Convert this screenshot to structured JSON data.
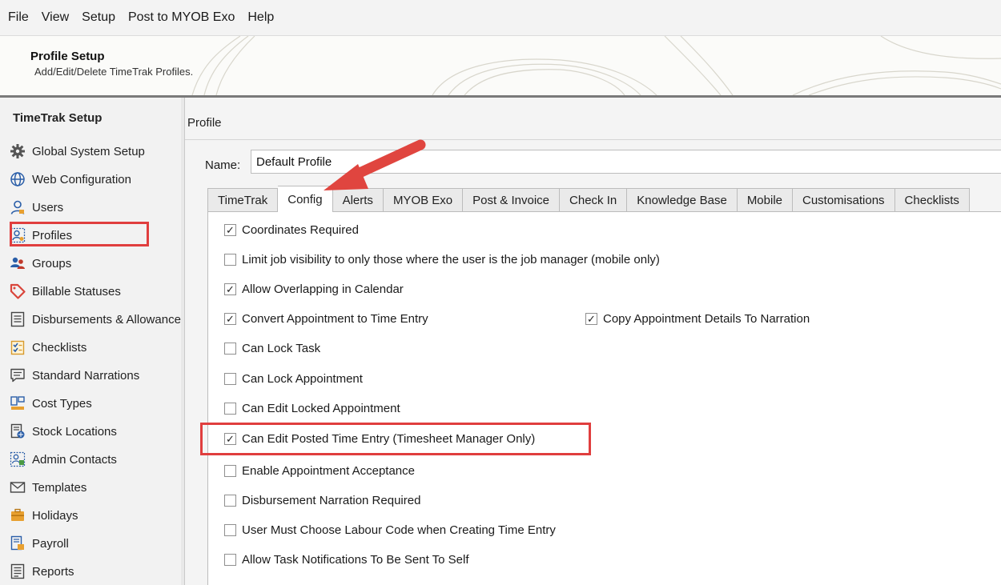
{
  "menu": [
    "File",
    "View",
    "Setup",
    "Post to MYOB Exo",
    "Help"
  ],
  "header": {
    "title": "Profile Setup",
    "subtitle": "Add/Edit/Delete TimeTrak Profiles."
  },
  "sidebar": {
    "title": "TimeTrak Setup",
    "items": [
      {
        "label": "Global System Setup",
        "icon": "gear-icon"
      },
      {
        "label": "Web Configuration",
        "icon": "globe-icon"
      },
      {
        "label": "Users",
        "icon": "user-icon"
      },
      {
        "label": "Profiles",
        "icon": "profile-icon"
      },
      {
        "label": "Groups",
        "icon": "group-icon"
      },
      {
        "label": "Billable Statuses",
        "icon": "tag-icon"
      },
      {
        "label": "Disbursements & Allowances",
        "icon": "list-icon"
      },
      {
        "label": "Checklists",
        "icon": "checklist-icon"
      },
      {
        "label": "Standard Narrations",
        "icon": "narration-icon"
      },
      {
        "label": "Cost Types",
        "icon": "cost-types-icon"
      },
      {
        "label": "Stock Locations",
        "icon": "stock-location-icon"
      },
      {
        "label": "Admin Contacts",
        "icon": "admin-contacts-icon"
      },
      {
        "label": "Templates",
        "icon": "envelope-icon"
      },
      {
        "label": "Holidays",
        "icon": "holiday-icon"
      },
      {
        "label": "Payroll",
        "icon": "payroll-icon"
      },
      {
        "label": "Reports",
        "icon": "report-icon"
      }
    ],
    "highlighted": "Profiles"
  },
  "main": {
    "title": "Profile",
    "name_label": "Name:",
    "name_value": "Default Profile",
    "tabs": [
      "TimeTrak",
      "Config",
      "Alerts",
      "MYOB Exo",
      "Post & Invoice",
      "Check In",
      "Knowledge Base",
      "Mobile",
      "Customisations",
      "Checklists"
    ],
    "active_tab": "Config",
    "options": [
      {
        "label": "Coordinates Required",
        "checked": true
      },
      {
        "label": "Limit job visibility to only those where the user is the job manager (mobile only)",
        "checked": false
      },
      {
        "label": "Allow Overlapping in Calendar",
        "checked": true
      },
      {
        "label": "Convert Appointment to Time Entry",
        "checked": true
      },
      {
        "label": "Copy Appointment Details To Narration",
        "checked": true
      },
      {
        "label": "Can Lock Task",
        "checked": false
      },
      {
        "label": "Can Lock Appointment",
        "checked": false
      },
      {
        "label": "Can Edit Locked Appointment",
        "checked": false
      },
      {
        "label": "Can Edit Posted Time Entry (Timesheet Manager Only)",
        "checked": true
      },
      {
        "label": "Enable Appointment Acceptance",
        "checked": false
      },
      {
        "label": "Disbursement Narration Required",
        "checked": false
      },
      {
        "label": "User Must Choose Labour Code when Creating Time Entry",
        "checked": false
      },
      {
        "label": "Allow Task Notifications To Be Sent To Self",
        "checked": false
      }
    ]
  },
  "colors": {
    "highlight": "#e03e3e",
    "arrow": "#e0453f",
    "header_bg": "#fbfbf9"
  }
}
